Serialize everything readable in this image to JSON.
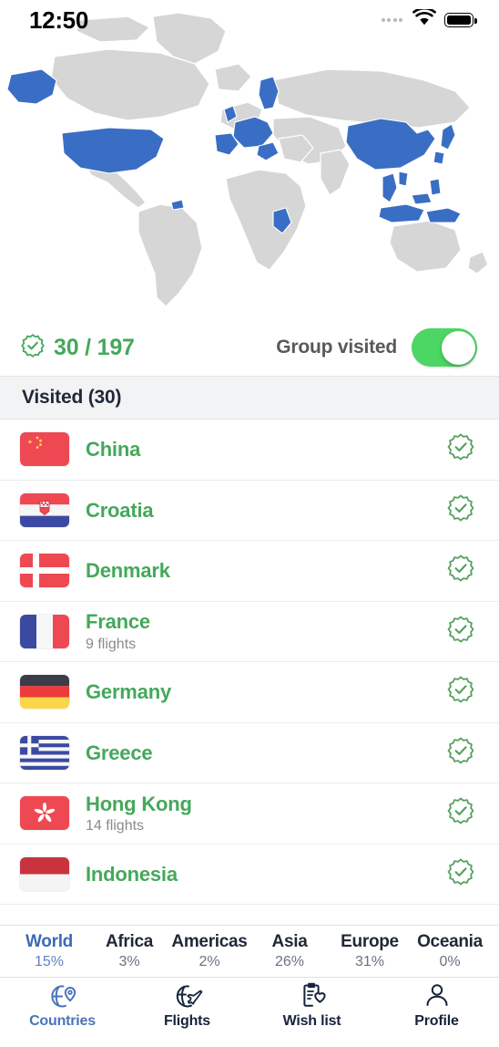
{
  "status_bar": {
    "time": "12:50",
    "signal_icon": "signal-dots-icon",
    "wifi_icon": "wifi-icon",
    "battery_icon": "battery-full-icon"
  },
  "map": {
    "icon": "world-map",
    "visited_fill": "#3a6ec4",
    "unvisited_fill": "#d6d6d6",
    "background": "#ffffff"
  },
  "summary": {
    "badge_icon": "badge-check-icon",
    "count_text": "30 / 197",
    "toggle_label": "Group visited",
    "toggle_on": true,
    "accent_green": "#45a85b",
    "toggle_green": "#4cd663"
  },
  "section": {
    "title": "Visited (30)"
  },
  "countries": [
    {
      "name": "China",
      "flag": "flag-china",
      "subtitle": "",
      "badge": "badge-check-icon"
    },
    {
      "name": "Croatia",
      "flag": "flag-croatia",
      "subtitle": "",
      "badge": "badge-check-icon"
    },
    {
      "name": "Denmark",
      "flag": "flag-denmark",
      "subtitle": "",
      "badge": "badge-check-icon"
    },
    {
      "name": "France",
      "flag": "flag-france",
      "subtitle": "9 flights",
      "badge": "badge-check-icon"
    },
    {
      "name": "Germany",
      "flag": "flag-germany",
      "subtitle": "",
      "badge": "badge-check-icon"
    },
    {
      "name": "Greece",
      "flag": "flag-greece",
      "subtitle": "",
      "badge": "badge-check-icon"
    },
    {
      "name": "Hong Kong",
      "flag": "flag-hong-kong",
      "subtitle": "14 flights",
      "badge": "badge-check-icon"
    },
    {
      "name": "Indonesia",
      "flag": "flag-indonesia",
      "subtitle": "",
      "badge": "badge-check-icon"
    }
  ],
  "continent_tabs": [
    {
      "label": "World",
      "percent": "15%",
      "active": true
    },
    {
      "label": "Africa",
      "percent": "3%",
      "active": false
    },
    {
      "label": "Americas",
      "percent": "2%",
      "active": false
    },
    {
      "label": "Asia",
      "percent": "26%",
      "active": false
    },
    {
      "label": "Europe",
      "percent": "31%",
      "active": false
    },
    {
      "label": "Oceania",
      "percent": "0%",
      "active": false
    }
  ],
  "tab_bar": [
    {
      "label": "Countries",
      "icon": "globe-pin-icon",
      "active": true
    },
    {
      "label": "Flights",
      "icon": "globe-plane-icon",
      "active": false
    },
    {
      "label": "Wish list",
      "icon": "clipboard-heart-icon",
      "active": false
    },
    {
      "label": "Profile",
      "icon": "person-icon",
      "active": false
    }
  ]
}
